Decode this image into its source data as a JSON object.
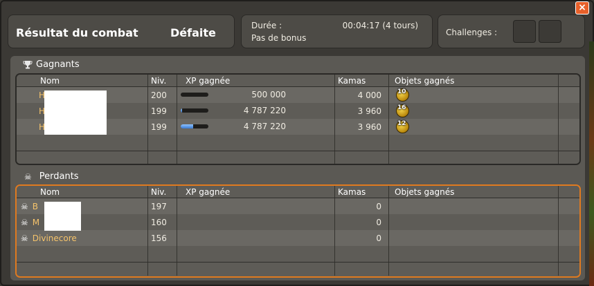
{
  "header": {
    "result_title": "Résultat du combat",
    "result_status": "Défaite",
    "duration_label": "Durée :",
    "duration_value": "00:04:17 (4 tours)",
    "bonus_text": "Pas de bonus",
    "challenges_label": "Challenges :"
  },
  "close_glyph": "×",
  "columns": {
    "name": "Nom",
    "level": "Niv.",
    "xp": "XP gagnée",
    "kamas": "Kamas",
    "objects": "Objets gagnés"
  },
  "winners": {
    "title": "Gagnants",
    "icon": "trophy-icon",
    "rows": [
      {
        "name": "H",
        "level": "200",
        "xp_value": "500 000",
        "xp_progress": 0.0,
        "kamas": "4 000",
        "object_count": "10"
      },
      {
        "name": "H",
        "level": "199",
        "xp_value": "4 787 220",
        "xp_progress": 0.05,
        "kamas": "3 960",
        "object_count": "16"
      },
      {
        "name": "H",
        "level": "199",
        "xp_value": "4 787 220",
        "xp_progress": 0.45,
        "kamas": "3 960",
        "object_count": "12"
      }
    ]
  },
  "losers": {
    "title": "Perdants",
    "icon": "skull-icon",
    "rows": [
      {
        "name": "B",
        "level": "197",
        "kamas": "0"
      },
      {
        "name": "M",
        "level": "160",
        "kamas": "0"
      },
      {
        "name": "Divinecore",
        "level": "156",
        "kamas": "0"
      }
    ]
  },
  "colors": {
    "player_name": "#f5c36b",
    "losers_border": "#e07a1f",
    "close_button": "#e8602a"
  }
}
